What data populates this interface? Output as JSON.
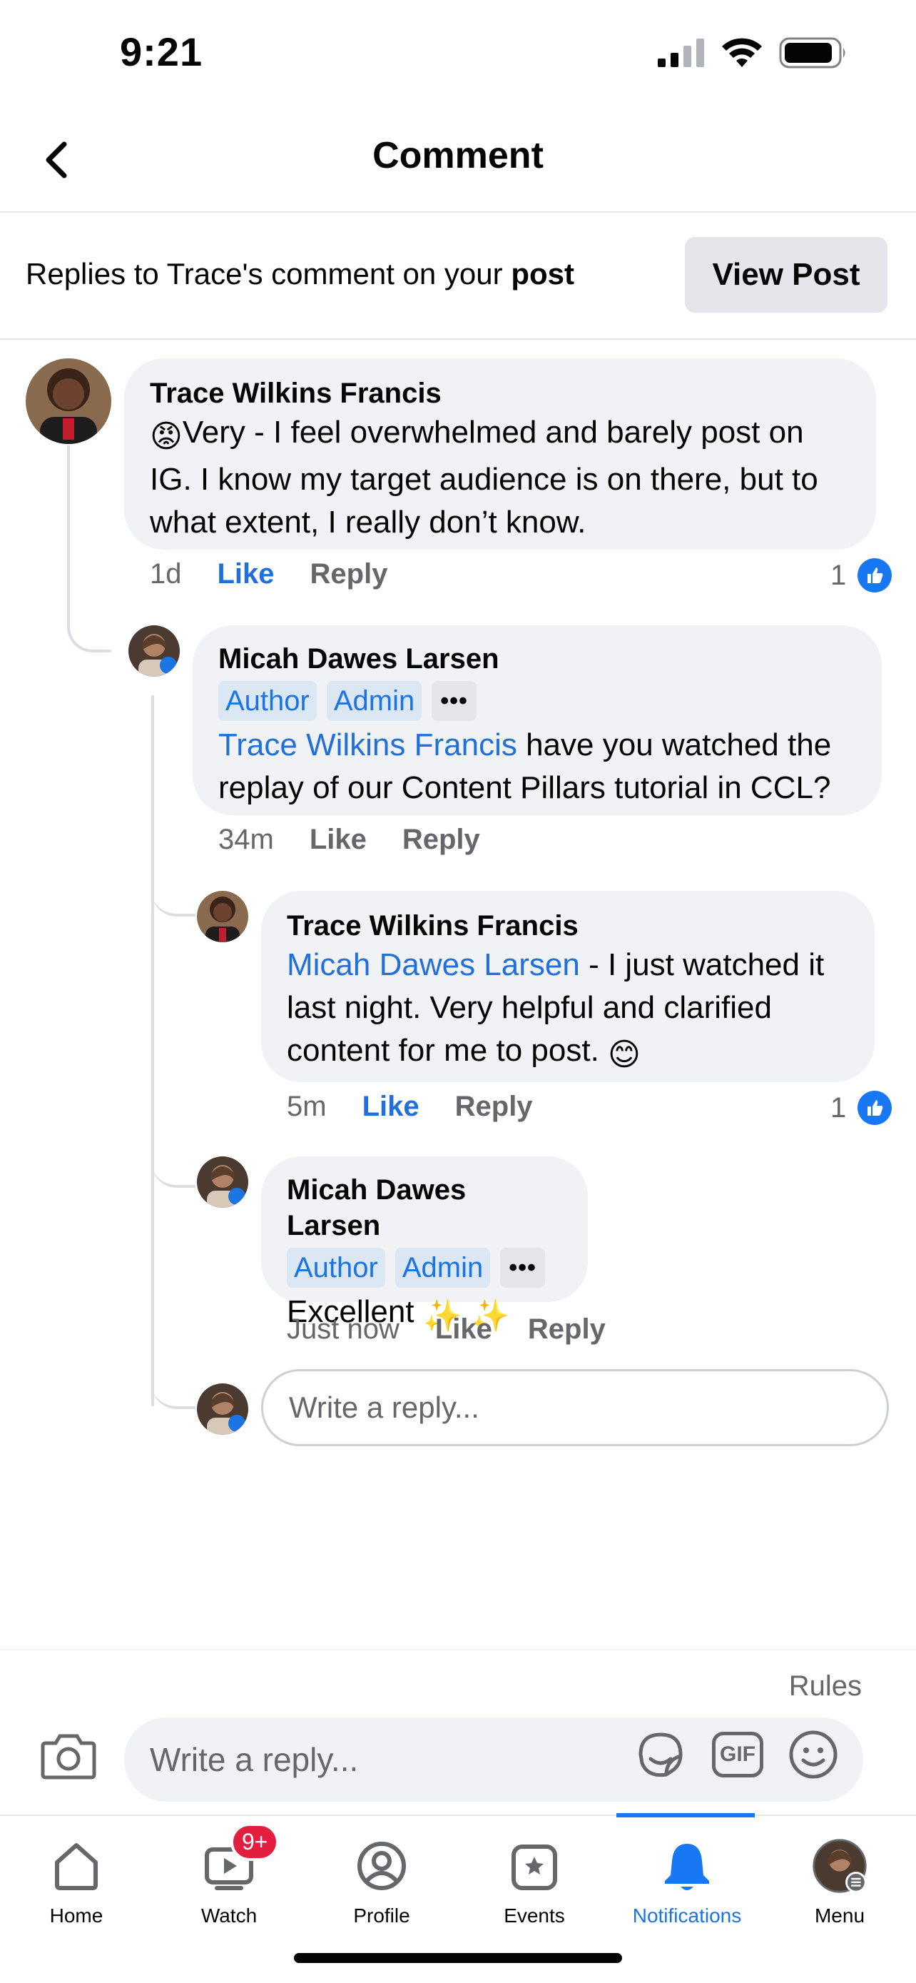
{
  "status_bar": {
    "time": "9:21"
  },
  "header": {
    "title": "Comment"
  },
  "info_bar": {
    "text_prefix": "Replies to Trace's comment on your ",
    "text_bold": "post",
    "view_post_label": "View Post"
  },
  "comments": [
    {
      "author": "Trace Wilkins Francis",
      "emoji": "😡",
      "text": "Very - I feel overwhelmed and barely post on IG. I know my target audience is on there, but to what extent, I really don’t know.",
      "time": "1d",
      "like_label": "Like",
      "reply_label": "Reply",
      "reaction_count": "1"
    },
    {
      "author": "Micah Dawes Larsen",
      "badges": [
        "Author",
        "Admin"
      ],
      "more": "•••",
      "mention": "Trace Wilkins Francis",
      "text": " have you watched the replay of our Content Pillars tutorial in CCL?",
      "time": "34m",
      "like_label": "Like",
      "reply_label": "Reply"
    },
    {
      "author": "Trace Wilkins Francis",
      "mention": "Micah Dawes Larsen",
      "text": " - I just watched it last night. Very helpful and clarified content for me to post. ",
      "emoji": "😊",
      "time": "5m",
      "like_label": "Like",
      "reply_label": "Reply",
      "reaction_count": "1"
    },
    {
      "author": "Micah Dawes Larsen",
      "badges": [
        "Author",
        "Admin"
      ],
      "more": "•••",
      "text": "Excellent ",
      "emoji": "✨ ✨",
      "time": "Just now",
      "like_label": "Like",
      "reply_label": "Reply"
    }
  ],
  "inline_reply": {
    "placeholder": "Write a reply..."
  },
  "composer": {
    "rules_label": "Rules",
    "placeholder": "Write a reply...",
    "gif_label": "GIF"
  },
  "tabs": [
    {
      "label": "Home",
      "icon": "home-icon"
    },
    {
      "label": "Watch",
      "icon": "watch-icon",
      "badge": "9+"
    },
    {
      "label": "Profile",
      "icon": "profile-icon"
    },
    {
      "label": "Events",
      "icon": "events-icon"
    },
    {
      "label": "Notifications",
      "icon": "bell-icon",
      "active": true
    },
    {
      "label": "Menu",
      "icon": "menu-avatar-icon"
    }
  ],
  "colors": {
    "accent": "#1877f2",
    "mention": "#216fdb",
    "bubble": "#f0f2f5",
    "badge_bg": "#dbe7f2",
    "notif_badge": "#e41e3f"
  }
}
